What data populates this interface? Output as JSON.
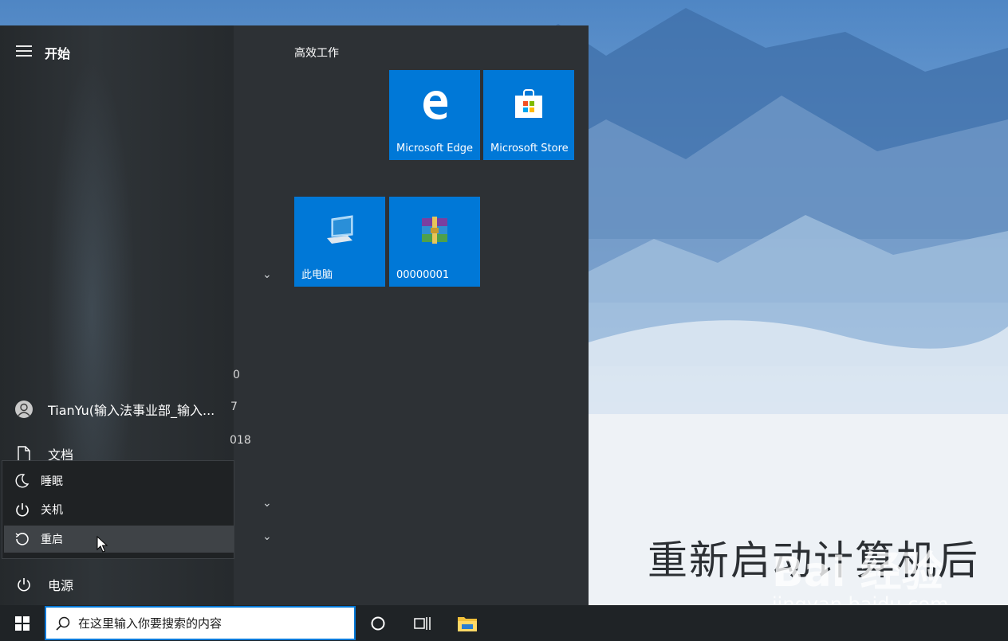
{
  "start_menu": {
    "title": "开始",
    "user": {
      "name": "TianYu(输入法事业部_输入..."
    },
    "nav": {
      "documents": "文档",
      "power": "电源"
    },
    "power_menu": {
      "sleep": "睡眠",
      "shutdown": "关机",
      "restart": "重启"
    },
    "app_list_partial": [
      "0",
      "7",
      "018"
    ],
    "tile_group": "高效工作",
    "tiles": [
      {
        "label": "Microsoft Edge",
        "icon": "edge-icon"
      },
      {
        "label": "Microsoft Store",
        "icon": "store-icon"
      },
      {
        "label": "此电脑",
        "icon": "this-pc-icon"
      },
      {
        "label": "00000001",
        "icon": "winrar-archive-icon"
      }
    ]
  },
  "taskbar": {
    "search_placeholder": "在这里输入你要搜索的内容",
    "icons": [
      "windows-logo-icon",
      "search-icon",
      "cortana-icon",
      "task-view-icon",
      "file-explorer-icon"
    ]
  },
  "overlay": {
    "caption": "重新启动计算机后",
    "watermark": "Bai 经验",
    "watermark_url": "jingyan.baidu.com"
  },
  "colors": {
    "tile_blue": "#0078d7",
    "menu_bg": "#2d3135",
    "taskbar_bg": "#1f2326"
  }
}
